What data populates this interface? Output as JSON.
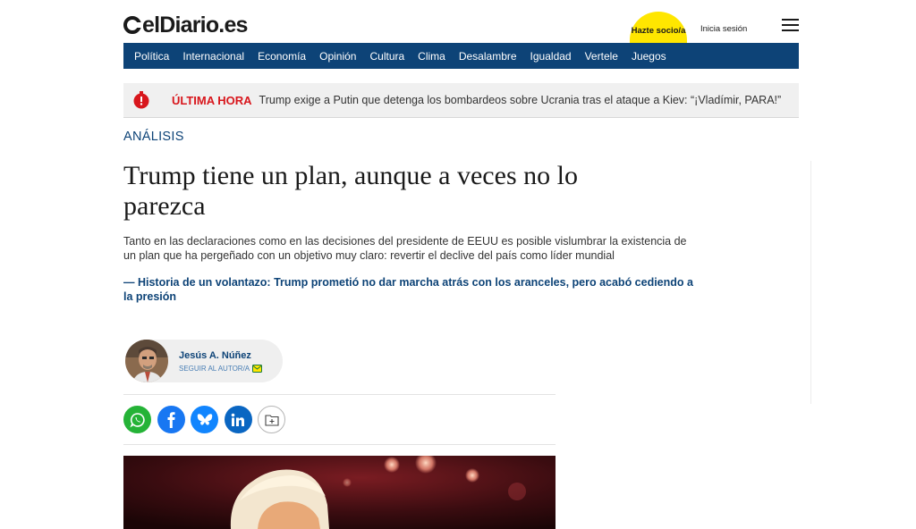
{
  "header": {
    "logo_text": "elDiario.es",
    "socio_label": "Hazte socio/a",
    "login_label": "Inicia sesión"
  },
  "nav": {
    "items": [
      "Política",
      "Internacional",
      "Economía",
      "Opinión",
      "Cultura",
      "Clima",
      "Desalambre",
      "Igualdad",
      "Vertele",
      "Juegos"
    ]
  },
  "breaking": {
    "label": "ÚLTIMA HORA",
    "text": "Trump exige a Putin que detenga los bombardeos sobre Ucrania tras el ataque a Kiev: “¡Vladímir, PARA!”"
  },
  "article": {
    "section": "ANÁLISIS",
    "headline": "Trump tiene un plan, aunque a veces no lo parezca",
    "lead": "Tanto en las declaraciones como en las decisiones del presidente de EEUU es posible vislumbrar la existencia de un plan que ha pergeñado con un objetivo muy claro: revertir el declive del país como líder mundial",
    "related": "— Historia de un volantazo: Trump prometió no dar marcha atrás con los aranceles, pero acabó cediendo a la presión"
  },
  "author": {
    "name": "Jesús A. Núñez",
    "follow_label": "SEGUIR AL AUTOR/A"
  },
  "share": {
    "buttons": [
      "whatsapp-icon",
      "facebook-icon",
      "bluesky-icon",
      "linkedin-icon",
      "save-folder-icon"
    ]
  },
  "colors": {
    "brand_blue": "#0d4377",
    "breaking_red": "#d8161c",
    "socio_yellow": "#ffe600",
    "whatsapp": "#25b337",
    "facebook": "#1877f2",
    "bluesky": "#1185fe",
    "linkedin": "#0a66c2"
  }
}
